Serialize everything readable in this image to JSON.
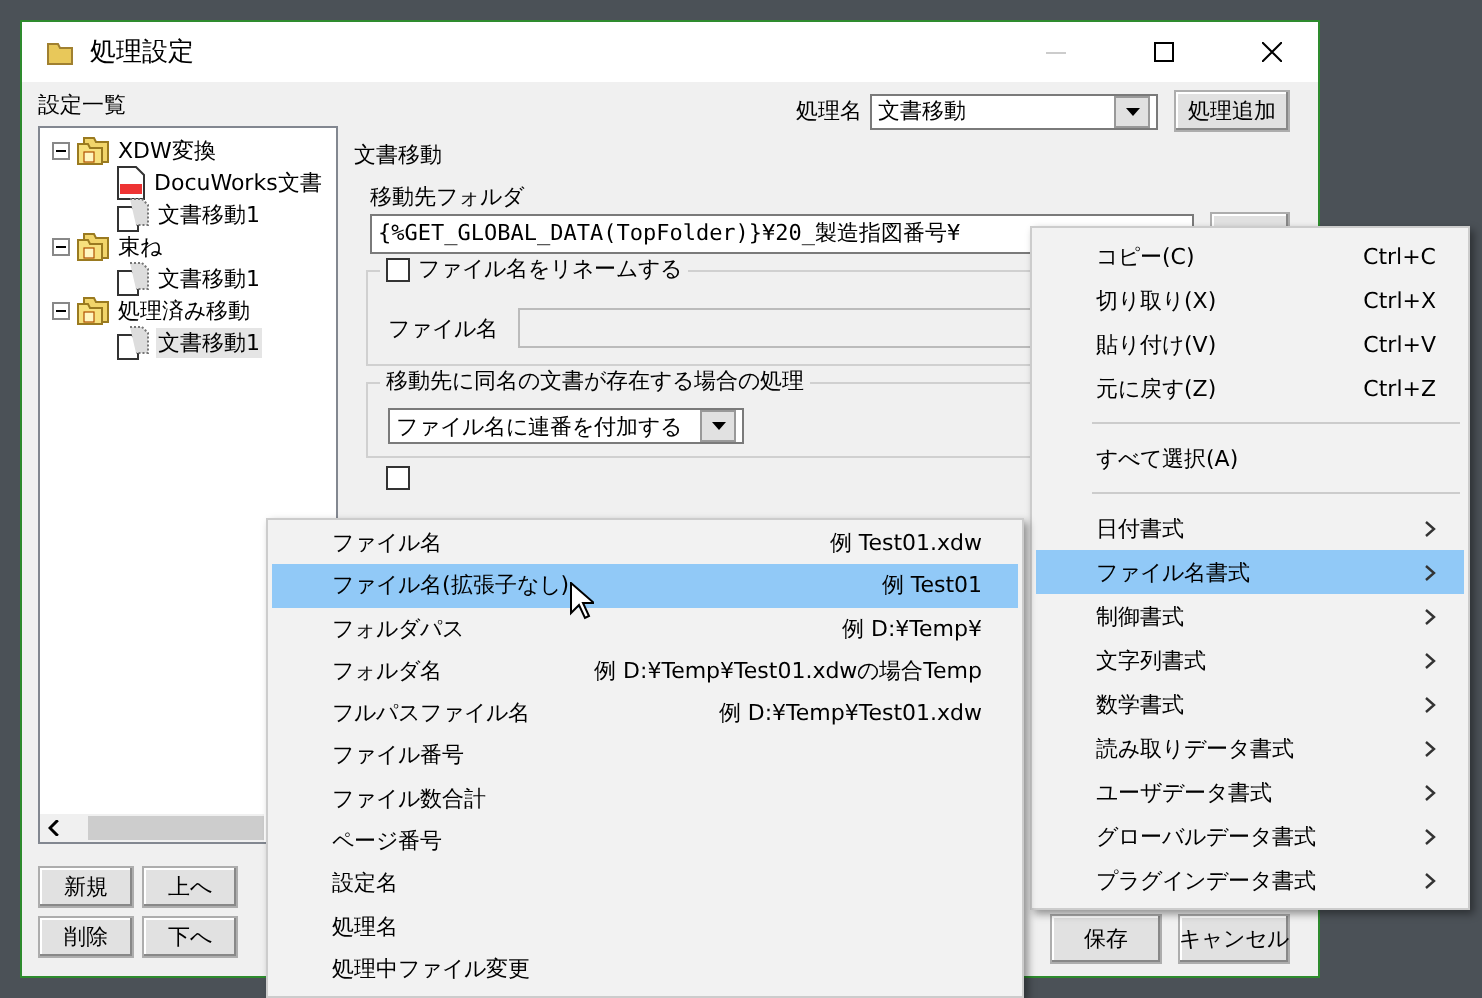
{
  "window": {
    "title": "処理設定"
  },
  "settings_list": {
    "label": "設定一覧",
    "tree": [
      {
        "kind": "folder",
        "label": "XDW変換",
        "expanded": true,
        "selected": false,
        "children": [
          {
            "kind": "docuworks",
            "label": "DocuWorks文書",
            "selected": false
          },
          {
            "kind": "document",
            "label": "文書移動1",
            "selected": false
          }
        ]
      },
      {
        "kind": "folder",
        "label": "束ね",
        "expanded": true,
        "selected": false,
        "children": [
          {
            "kind": "document",
            "label": "文書移動1",
            "selected": false
          }
        ]
      },
      {
        "kind": "folder",
        "label": "処理済み移動",
        "expanded": true,
        "selected": false,
        "children": [
          {
            "kind": "document",
            "label": "文書移動1",
            "selected": true
          }
        ]
      }
    ],
    "buttons": [
      "新規",
      "上へ",
      "削除",
      "下へ"
    ]
  },
  "process": {
    "label": "処理名",
    "value": "文書移動",
    "add_button": "処理追加"
  },
  "section_title": "文書移動",
  "destination": {
    "label": "移動先フォルダ",
    "value": "{%GET_GLOBAL_DATA(TopFolder)}¥20_製造指図番号¥"
  },
  "rename": {
    "label": "ファイル名をリネームする",
    "checked": false,
    "filename_label": "ファイル名"
  },
  "duplicate": {
    "title": "移動先に同名の文書が存在する場合の処理",
    "value": "ファイル名に連番を付加する"
  },
  "split": {
    "checked": false
  },
  "footer_buttons": [
    "保存",
    "キャンセル"
  ],
  "context_menu": [
    {
      "kind": "item",
      "label": "コピー(C)",
      "shortcut": "Ctrl+C",
      "selected": false
    },
    {
      "kind": "item",
      "label": "切り取り(X)",
      "shortcut": "Ctrl+X",
      "selected": false
    },
    {
      "kind": "item",
      "label": "貼り付け(V)",
      "shortcut": "Ctrl+V",
      "selected": false
    },
    {
      "kind": "item",
      "label": "元に戻す(Z)",
      "shortcut": "Ctrl+Z",
      "selected": false
    },
    {
      "kind": "separator"
    },
    {
      "kind": "item",
      "label": "すべて選択(A)",
      "selected": false
    },
    {
      "kind": "separator"
    },
    {
      "kind": "submenu",
      "label": "日付書式",
      "selected": false
    },
    {
      "kind": "submenu",
      "label": "ファイル名書式",
      "selected": true
    },
    {
      "kind": "submenu",
      "label": "制御書式",
      "selected": false
    },
    {
      "kind": "submenu",
      "label": "文字列書式",
      "selected": false
    },
    {
      "kind": "submenu",
      "label": "数学書式",
      "selected": false
    },
    {
      "kind": "submenu",
      "label": "読み取りデータ書式",
      "selected": false
    },
    {
      "kind": "submenu",
      "label": "ユーザデータ書式",
      "selected": false
    },
    {
      "kind": "submenu",
      "label": "グローバルデータ書式",
      "selected": false
    },
    {
      "kind": "submenu",
      "label": "プラグインデータ書式",
      "selected": false
    }
  ],
  "submenu": [
    {
      "label": "ファイル名",
      "example": "例 Test01.xdw",
      "selected": false
    },
    {
      "label": "ファイル名(拡張子なし)",
      "example": "例 Test01",
      "selected": true
    },
    {
      "label": "フォルダパス",
      "example": "例 D:¥Temp¥",
      "selected": false
    },
    {
      "label": "フォルダ名",
      "example": "例 D:¥Temp¥Test01.xdwの場合Temp",
      "selected": false
    },
    {
      "label": "フルパスファイル名",
      "example": "例 D:¥Temp¥Test01.xdw",
      "selected": false
    },
    {
      "label": "ファイル番号",
      "selected": false
    },
    {
      "label": "ファイル数合計",
      "selected": false
    },
    {
      "label": "ページ番号",
      "selected": false
    },
    {
      "label": "設定名",
      "selected": false
    },
    {
      "label": "処理名",
      "selected": false
    },
    {
      "label": "処理中ファイル変更",
      "selected": false
    }
  ]
}
